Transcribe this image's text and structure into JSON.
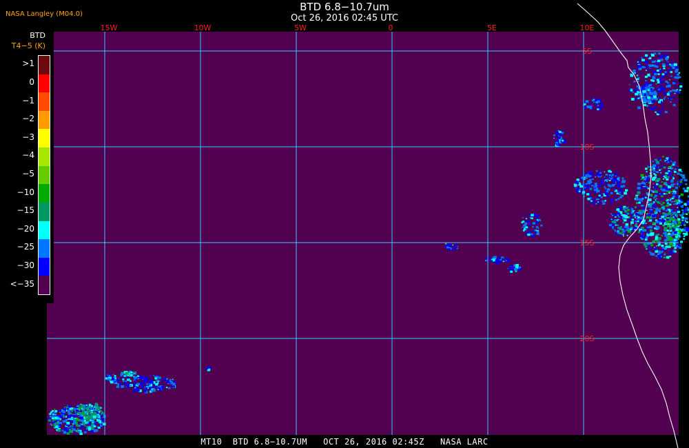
{
  "header": {
    "title": "BTD 6.8−10.7um",
    "subtitle": "Oct 26, 2016 02:45 UTC",
    "source": "NASA Langley (M04.0)"
  },
  "legend": {
    "label": "BTD",
    "unit": "T4−5 (K)",
    "entries": [
      {
        "label": ">1",
        "color": "#6b0a0f"
      },
      {
        "label": "0",
        "color": "#ff0000"
      },
      {
        "label": "−1",
        "color": "#ff4a00"
      },
      {
        "label": "−2",
        "color": "#ff9a00"
      },
      {
        "label": "−3",
        "color": "#ffff00"
      },
      {
        "label": "−4",
        "color": "#a6e600"
      },
      {
        "label": "−5",
        "color": "#66cc00"
      },
      {
        "label": "−10",
        "color": "#00aa00"
      },
      {
        "label": "−15",
        "color": "#009966"
      },
      {
        "label": "−20",
        "color": "#00ffff"
      },
      {
        "label": "−25",
        "color": "#0077ff"
      },
      {
        "label": "−30",
        "color": "#0000ff"
      },
      {
        "label": "<−35",
        "color": "#520050"
      }
    ]
  },
  "map": {
    "background_color": "#520050",
    "grid_color": "#33ccff",
    "label_color": "#ff2020",
    "coast_color": "#ffffff",
    "longitude_labels": [
      "15W",
      "10W",
      "5W",
      "0",
      "5E",
      "10E"
    ],
    "latitude_labels": [
      "5S",
      "10S",
      "15S",
      "20S"
    ],
    "lon_range_deg": [
      -18,
      15
    ],
    "lat_range_deg": [
      -26,
      -4
    ]
  },
  "footer": {
    "text": "MT10  BTD 6.8−10.7UM   OCT 26, 2016 02:45Z   NASA LARC"
  }
}
